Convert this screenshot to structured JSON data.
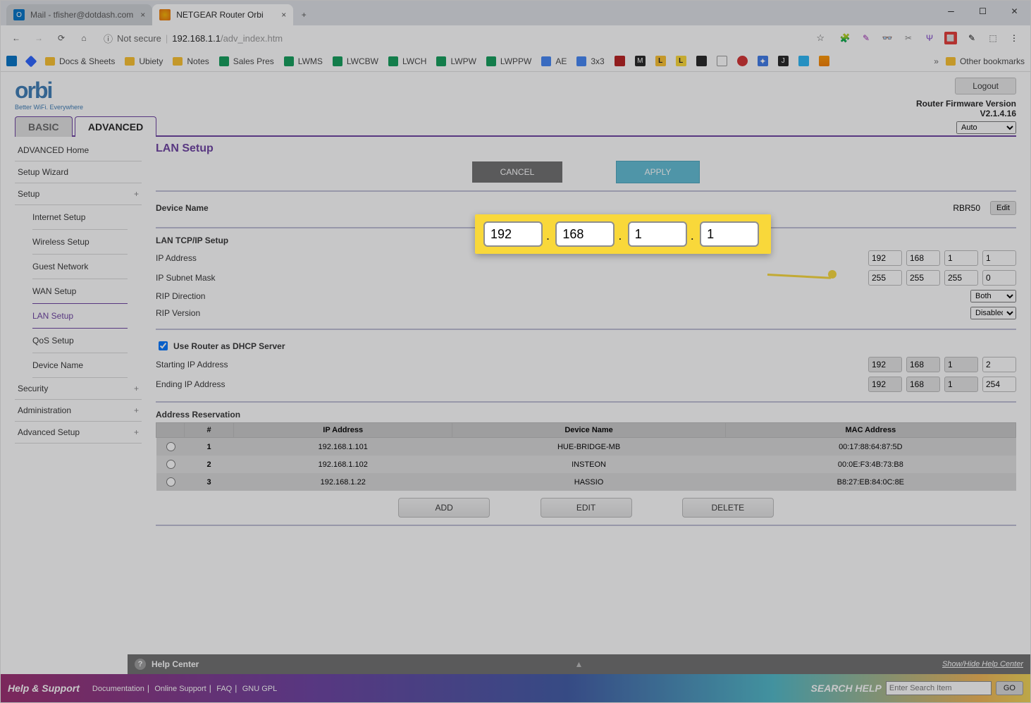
{
  "chrome": {
    "tab1": {
      "title": "Mail - tfisher@dotdash.com"
    },
    "tab2": {
      "title": "NETGEAR Router Orbi"
    },
    "url_prefix": "Not secure",
    "url_host": "192.168.1.1",
    "url_path": "/adv_index.htm"
  },
  "bookmarks": {
    "docs_sheets": "Docs & Sheets",
    "ubiety": "Ubiety",
    "notes": "Notes",
    "sales_pres": "Sales Pres",
    "lwms": "LWMS",
    "lwcbw": "LWCBW",
    "lwch": "LWCH",
    "lwpw": "LWPW",
    "lwppw": "LWPPW",
    "ae": "AE",
    "three": "3x3",
    "other": "Other bookmarks"
  },
  "header": {
    "logo": "orbi",
    "logo_sub": "Better WiFi. Everywhere",
    "logout": "Logout",
    "firmware_label": "Router Firmware Version",
    "firmware_ver": "V2.1.4.16",
    "auto": "Auto"
  },
  "tabs": {
    "basic": "BASIC",
    "advanced": "ADVANCED"
  },
  "sidebar": {
    "adv_home": "ADVANCED Home",
    "setup_wizard": "Setup Wizard",
    "setup": "Setup",
    "internet": "Internet Setup",
    "wireless": "Wireless Setup",
    "guest": "Guest Network",
    "wan": "WAN Setup",
    "lan": "LAN Setup",
    "qos": "QoS Setup",
    "devname": "Device Name",
    "security": "Security",
    "administration": "Administration",
    "adv_setup": "Advanced Setup"
  },
  "lan": {
    "title": "LAN Setup",
    "cancel": "CANCEL",
    "apply": "APPLY",
    "device_name": "Device Name",
    "device_name_val": "RBR50",
    "edit": "Edit",
    "section": "LAN TCP/IP Setup",
    "ip_label": "IP Address",
    "ip": [
      "192",
      "168",
      "1",
      "1"
    ],
    "subnet_label": "IP Subnet Mask",
    "subnet": [
      "255",
      "255",
      "255",
      "0"
    ],
    "rip_dir": "RIP Direction",
    "rip_dir_val": "Both",
    "rip_ver": "RIP Version",
    "rip_ver_val": "Disabled",
    "dhcp_label": "Use Router as DHCP Server",
    "start_label": "Starting IP Address",
    "start": [
      "192",
      "168",
      "1",
      "2"
    ],
    "end_label": "Ending IP Address",
    "end": [
      "192",
      "168",
      "1",
      "254"
    ],
    "ar_title": "Address Reservation",
    "cols": {
      "num": "#",
      "ip": "IP Address",
      "name": "Device Name",
      "mac": "MAC Address"
    },
    "rows": [
      {
        "n": "1",
        "ip": "192.168.1.101",
        "name": "HUE-BRIDGE-MB",
        "mac": "00:17:88:64:87:5D"
      },
      {
        "n": "2",
        "ip": "192.168.1.102",
        "name": "INSTEON",
        "mac": "00:0E:F3:4B:73:B8"
      },
      {
        "n": "3",
        "ip": "192.168.1.22",
        "name": "HASSIO",
        "mac": "B8:27:EB:84:0C:8E"
      }
    ],
    "add": "ADD",
    "edit_btn": "EDIT",
    "delete": "DELETE"
  },
  "magnifier": {
    "ip": [
      "192",
      "168",
      "1",
      "1"
    ]
  },
  "help": {
    "title": "Help Center",
    "showhide": "Show/Hide Help Center"
  },
  "support": {
    "title": "Help & Support",
    "doc": "Documentation",
    "online": "Online Support",
    "faq": "FAQ",
    "gnu": "GNU GPL",
    "search_label": "SEARCH HELP",
    "placeholder": "Enter Search Item",
    "go": "GO"
  }
}
